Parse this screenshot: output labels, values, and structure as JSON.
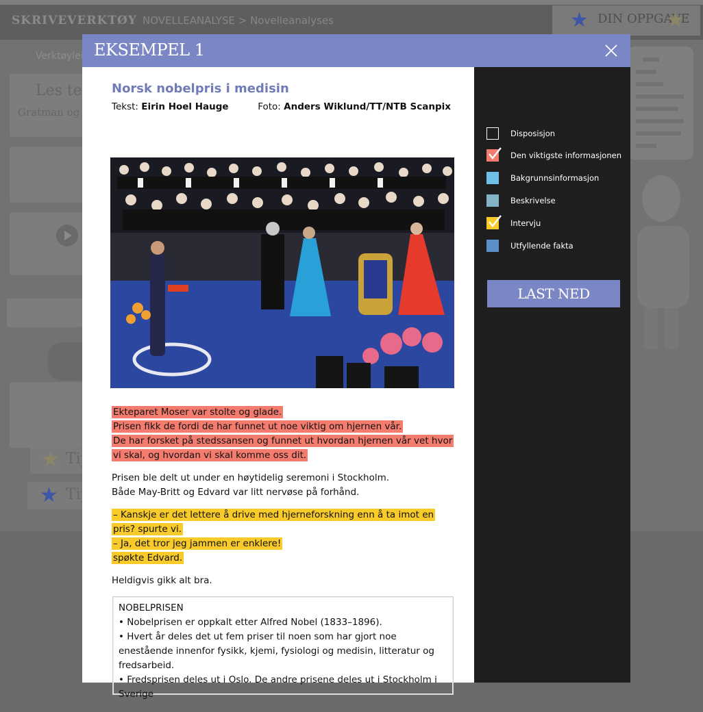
{
  "background": {
    "app_title": "SKRIVEVERKTØY",
    "breadcrumb": "NOVELLEANALYSE > Novelleanalyses",
    "task_label": "DIN OPPGAVE",
    "tool_label": "Verktøylei",
    "card_title": "Les teks",
    "card_subtitle": "Gratman og jul",
    "tip1": "Tip",
    "tip2": "Tip"
  },
  "modal": {
    "title": "EKSEMPEL 1",
    "close_icon": "close-icon",
    "article": {
      "title": "Norsk nobelpris i medisin",
      "text_label": "Tekst:",
      "text_author": "Eirin Hoel Hauge",
      "photo_label": "Foto:",
      "photo_credit": "Anders Wiklund/TT/NTB Scanpix",
      "photo_icon": "nobel-ceremony-photo",
      "red1": "Ekteparet Moser var stolte og glade.",
      "red2": "Prisen fikk de fordi de har funnet ut noe viktig om hjernen vår.",
      "red3": "De har forsket på stedssansen og funnet ut hvordan hjernen vår vet hvor vi skal, og hvordan vi skal komme oss dit.",
      "plain1": "Prisen ble delt ut under en høytidelig seremoni i Stockholm.",
      "plain2": "Både May-Britt og Edvard var litt nervøse på forhånd.",
      "yellow1": "– Kanskje er det lettere å drive med hjerneforskning enn å ta imot en pris? spurte vi.",
      "yellow2": "– Ja, det tror jeg jammen er enklere!",
      "yellow3": "spøkte Edvard.",
      "plain3": "Heldigvis gikk alt bra."
    },
    "factbox": {
      "heading": "NOBELPRISEN",
      "item1": "• Nobelprisen er oppkalt etter Alfred Nobel (1833–1896).",
      "item2": "• Hvert år deles det ut fem priser til noen som har gjort noe enestående innenfor fysikk, kjemi, fysiologi og medisin, litteratur og fredsarbeid.",
      "item3": "• Fredsprisen deles ut i Oslo. De andre prisene deles ut i Stockholm i Sverige"
    },
    "legend": [
      {
        "label": "Disposisjon",
        "color": "#1e1e1e",
        "checked": false
      },
      {
        "label": "Den viktigste informasjonen",
        "color": "#f37c6f",
        "checked": true
      },
      {
        "label": "Bakgrunnsinformasjon",
        "color": "#6fc0e8",
        "checked": false
      },
      {
        "label": "Beskrivelse",
        "color": "#84b3c6",
        "checked": false
      },
      {
        "label": "Intervju",
        "color": "#f8ca2a",
        "checked": true
      },
      {
        "label": "Utfyllende fakta",
        "color": "#5c8ec8",
        "checked": false
      }
    ],
    "download_label": "LAST NED"
  }
}
